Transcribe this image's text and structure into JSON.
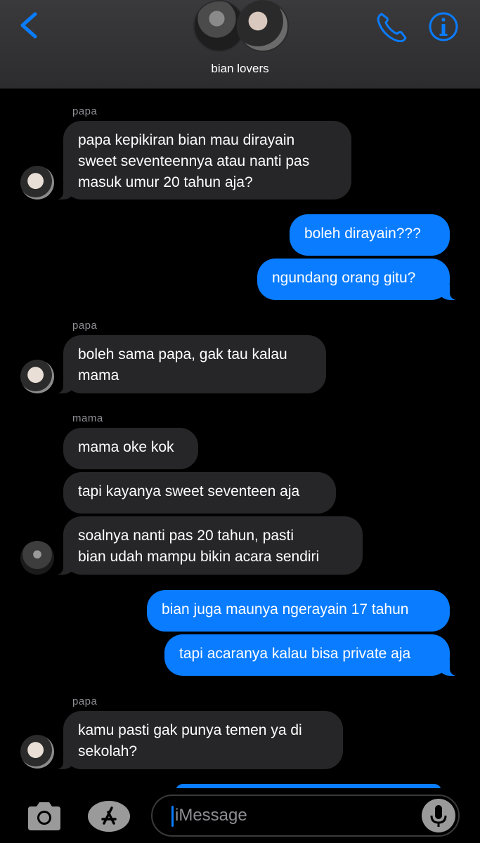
{
  "header": {
    "title": "bian lovers",
    "back_icon": "chevron-left-icon",
    "call_icon": "phone-icon",
    "info_icon": "info-icon",
    "accent_color": "#0a7cff"
  },
  "messages": [
    {
      "sender": "papa",
      "text_lines": [
        "papa kepikiran bian mau dirayain",
        "sweet seventeennya atau nanti pas",
        "masuk umur 20 tahun aja?"
      ]
    },
    {
      "text": "boleh dirayain???"
    },
    {
      "text": "ngundang orang gitu?"
    },
    {
      "sender": "papa",
      "text_lines": [
        "boleh sama papa, gak tau kalau",
        "mama"
      ]
    },
    {
      "sender": "mama",
      "text": "mama oke kok"
    },
    {
      "text": "tapi kayanya sweet seventeen aja"
    },
    {
      "text_lines": [
        "soalnya nanti pas 20 tahun, pasti",
        "bian udah mampu bikin acara sendiri"
      ]
    },
    {
      "text": "bian juga maunya ngerayain 17 tahun"
    },
    {
      "text": "tapi acaranya kalau bisa private aja"
    },
    {
      "sender": "papa",
      "text_lines": [
        "kamu pasti gak punya temen ya di",
        "sekolah?"
      ]
    }
  ],
  "composer": {
    "placeholder": "iMessage",
    "camera_icon": "camera-icon",
    "apps_icon": "app-store-icon",
    "mic_icon": "microphone-icon"
  }
}
